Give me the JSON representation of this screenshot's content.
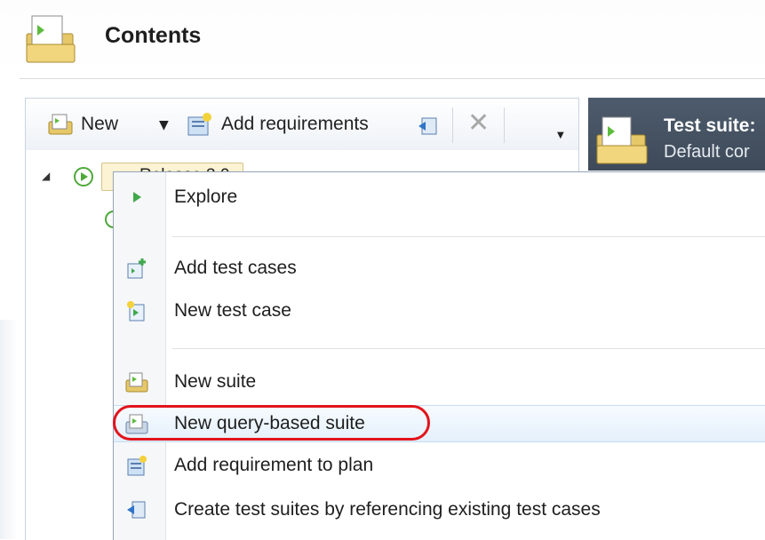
{
  "header": {
    "title": "Contents",
    "icon": "suite-folder-icon"
  },
  "toolbar": {
    "new_label": "New",
    "add_requirements_label": "Add requirements"
  },
  "tree": {
    "root_label": "Release 3.0"
  },
  "right_panel": {
    "title": "Test suite:",
    "subtitle": "Default cor"
  },
  "context_menu": {
    "items": [
      {
        "label": "Explore",
        "icon": "play-icon"
      },
      {
        "label": "Add test cases",
        "icon": "add-test-cases-icon"
      },
      {
        "label": "New test case",
        "icon": "new-test-case-icon"
      },
      {
        "label": "New suite",
        "icon": "new-suite-icon"
      },
      {
        "label": "New query-based suite",
        "icon": "query-suite-icon"
      },
      {
        "label": "Add requirement to plan",
        "icon": "add-requirement-icon"
      },
      {
        "label": "Create test suites by referencing existing test cases",
        "icon": "reference-suites-icon"
      }
    ],
    "highlighted_item": "New query-based suite",
    "highlight_color": "#e2141c"
  }
}
